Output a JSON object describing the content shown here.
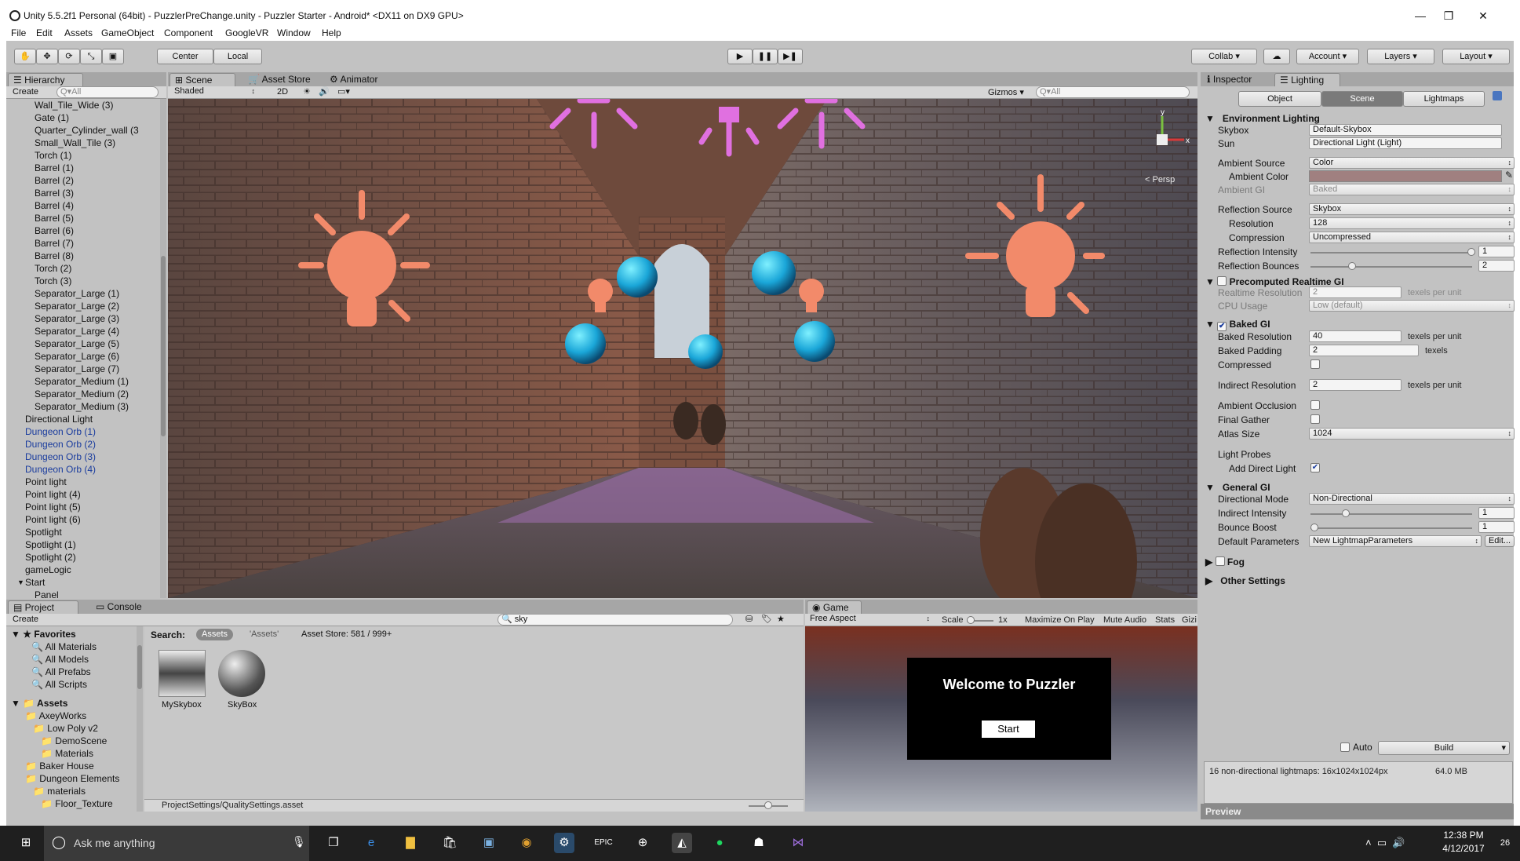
{
  "window": {
    "title": "Unity 5.5.2f1 Personal (64bit) - PuzzlerPreChange.unity - Puzzler Starter - Android* <DX11 on DX9 GPU>",
    "minimize": "—",
    "maximize": "❐",
    "close": "✕"
  },
  "menu": [
    "File",
    "Edit",
    "Assets",
    "GameObject",
    "Component",
    "GoogleVR",
    "Window",
    "Help"
  ],
  "toolbar": {
    "pivot": "Center",
    "space": "Local",
    "collab": "Collab",
    "account": "Account",
    "layers": "Layers",
    "layout": "Layout"
  },
  "hierarchy": {
    "tab": "Hierarchy",
    "create": "Create",
    "search_placeholder": "Q▾All",
    "items": [
      {
        "label": "Wall_Tile_Wide (3)",
        "indent": 2,
        "blue": false
      },
      {
        "label": "Gate (1)",
        "indent": 2,
        "blue": false
      },
      {
        "label": "Quarter_Cylinder_wall (3",
        "indent": 2,
        "blue": false
      },
      {
        "label": "Small_Wall_Tile (3)",
        "indent": 2,
        "blue": false
      },
      {
        "label": "Torch (1)",
        "indent": 2,
        "blue": false
      },
      {
        "label": "Barrel (1)",
        "indent": 2,
        "blue": false
      },
      {
        "label": "Barrel (2)",
        "indent": 2,
        "blue": false
      },
      {
        "label": "Barrel (3)",
        "indent": 2,
        "blue": false
      },
      {
        "label": "Barrel (4)",
        "indent": 2,
        "blue": false
      },
      {
        "label": "Barrel (5)",
        "indent": 2,
        "blue": false
      },
      {
        "label": "Barrel (6)",
        "indent": 2,
        "blue": false
      },
      {
        "label": "Barrel (7)",
        "indent": 2,
        "blue": false
      },
      {
        "label": "Barrel (8)",
        "indent": 2,
        "blue": false
      },
      {
        "label": "Torch (2)",
        "indent": 2,
        "blue": false
      },
      {
        "label": "Torch (3)",
        "indent": 2,
        "blue": false
      },
      {
        "label": "Separator_Large (1)",
        "indent": 2,
        "blue": false
      },
      {
        "label": "Separator_Large (2)",
        "indent": 2,
        "blue": false
      },
      {
        "label": "Separator_Large (3)",
        "indent": 2,
        "blue": false
      },
      {
        "label": "Separator_Large (4)",
        "indent": 2,
        "blue": false
      },
      {
        "label": "Separator_Large (5)",
        "indent": 2,
        "blue": false
      },
      {
        "label": "Separator_Large (6)",
        "indent": 2,
        "blue": false
      },
      {
        "label": "Separator_Large (7)",
        "indent": 2,
        "blue": false
      },
      {
        "label": "Separator_Medium (1)",
        "indent": 2,
        "blue": false
      },
      {
        "label": "Separator_Medium (2)",
        "indent": 2,
        "blue": false
      },
      {
        "label": "Separator_Medium (3)",
        "indent": 2,
        "blue": false
      },
      {
        "label": "Directional Light",
        "indent": 1,
        "blue": false
      },
      {
        "label": "Dungeon Orb (1)",
        "indent": 1,
        "blue": true
      },
      {
        "label": "Dungeon Orb (2)",
        "indent": 1,
        "blue": true
      },
      {
        "label": "Dungeon Orb (3)",
        "indent": 1,
        "blue": true
      },
      {
        "label": "Dungeon Orb (4)",
        "indent": 1,
        "blue": true
      },
      {
        "label": "Point light",
        "indent": 1,
        "blue": false
      },
      {
        "label": "Point light (4)",
        "indent": 1,
        "blue": false
      },
      {
        "label": "Point light (5)",
        "indent": 1,
        "blue": false
      },
      {
        "label": "Point light (6)",
        "indent": 1,
        "blue": false
      },
      {
        "label": "Spotlight",
        "indent": 1,
        "blue": false
      },
      {
        "label": "Spotlight (1)",
        "indent": 1,
        "blue": false
      },
      {
        "label": "Spotlight (2)",
        "indent": 1,
        "blue": false
      },
      {
        "label": "gameLogic",
        "indent": 1,
        "blue": false
      },
      {
        "label": "Start",
        "indent": 1,
        "blue": false
      },
      {
        "label": "Panel",
        "indent": 2,
        "blue": false
      }
    ]
  },
  "scene": {
    "tabs": [
      "Scene",
      "Asset Store",
      "Animator"
    ],
    "shading": "Shaded",
    "mode2d": "2D",
    "gizmos": "Gizmos",
    "search": "Q▾All",
    "persp": "< Persp"
  },
  "inspector": {
    "tabs": [
      "Inspector",
      "Lighting"
    ],
    "modes": [
      "Object",
      "Scene",
      "Lightmaps"
    ],
    "env": {
      "title": "Environment Lighting",
      "skybox_label": "Skybox",
      "skybox": "Default-Skybox",
      "sun_label": "Sun",
      "sun": "Directional Light (Light)",
      "ambient_source_label": "Ambient Source",
      "ambient_source": "Color",
      "ambient_color_label": "Ambient Color",
      "ambient_gi_label": "Ambient GI",
      "ambient_gi": "Baked",
      "refl_source_label": "Reflection Source",
      "refl_source": "Skybox",
      "resolution_label": "Resolution",
      "resolution": "128",
      "compression_label": "Compression",
      "compression": "Uncompressed",
      "refl_intensity_label": "Reflection Intensity",
      "refl_intensity": "1",
      "refl_bounces_label": "Reflection Bounces",
      "refl_bounces": "2"
    },
    "precomputed": {
      "title": "Precomputed Realtime GI",
      "rt_res_label": "Realtime Resolution",
      "rt_res": "2",
      "rt_units": "texels per unit",
      "cpu_label": "CPU Usage",
      "cpu": "Low (default)"
    },
    "baked": {
      "title": "Baked GI",
      "res_label": "Baked Resolution",
      "res": "40",
      "res_units": "texels per unit",
      "pad_label": "Baked Padding",
      "pad": "2",
      "pad_units": "texels",
      "compressed_label": "Compressed",
      "indirect_label": "Indirect Resolution",
      "indirect": "2",
      "indirect_units": "texels per unit",
      "ao_label": "Ambient Occlusion",
      "fg_label": "Final Gather",
      "atlas_label": "Atlas Size",
      "atlas": "1024",
      "probes_label": "Light Probes",
      "adl_label": "Add Direct Light"
    },
    "general": {
      "title": "General GI",
      "dir_label": "Directional Mode",
      "dir": "Non-Directional",
      "ii_label": "Indirect Intensity",
      "ii": "1",
      "bb_label": "Bounce Boost",
      "bb": "1",
      "dp_label": "Default Parameters",
      "dp": "New LightmapParameters",
      "edit": "Edit..."
    },
    "fog": "Fog",
    "other": "Other Settings",
    "auto": "Auto",
    "build": "Build",
    "stats": "16 non-directional lightmaps: 16x1024x1024px",
    "size": "64.0 MB",
    "preview": "Preview"
  },
  "project": {
    "tabs": [
      "Project",
      "Console"
    ],
    "create": "Create",
    "search_value": "sky",
    "search_label": "Search:",
    "scope_assets": "Assets",
    "scope_quoted": "'Assets'",
    "asset_store": "Asset Store: 581 / 999+",
    "favorites": "Favorites",
    "fav_items": [
      "All Materials",
      "All Models",
      "All Prefabs",
      "All Scripts"
    ],
    "assets_root": "Assets",
    "tree": [
      {
        "label": "AxeyWorks",
        "level": 1
      },
      {
        "label": "Low Poly v2",
        "level": 2
      },
      {
        "label": "DemoScene",
        "level": 3
      },
      {
        "label": "Materials",
        "level": 3
      },
      {
        "label": "Baker House",
        "level": 1
      },
      {
        "label": "Dungeon Elements",
        "level": 1
      },
      {
        "label": "materials",
        "level": 2
      },
      {
        "label": "Floor_Texture",
        "level": 3
      }
    ],
    "files": [
      {
        "label": "MySkybox"
      },
      {
        "label": "SkyBox"
      }
    ],
    "status_path": "ProjectSettings/QualitySettings.asset"
  },
  "game": {
    "tab": "Game",
    "aspect": "Free Aspect",
    "scale": "Scale",
    "scale_value": "1x",
    "maximize": "Maximize On Play",
    "mute": "Mute Audio",
    "stats": "Stats",
    "gizmos": "Gizi",
    "welcome": "Welcome to Puzzler",
    "start": "Start"
  },
  "taskbar": {
    "search": "Ask me anything",
    "time": "12:38 PM",
    "date": "4/12/2017",
    "badge": "26"
  },
  "colors": {
    "accent": "#3d6db5",
    "ambient": "#a08080",
    "bulb": "#f28a6a",
    "magenta": "#e070e0",
    "orb": "#1aa6d8"
  }
}
